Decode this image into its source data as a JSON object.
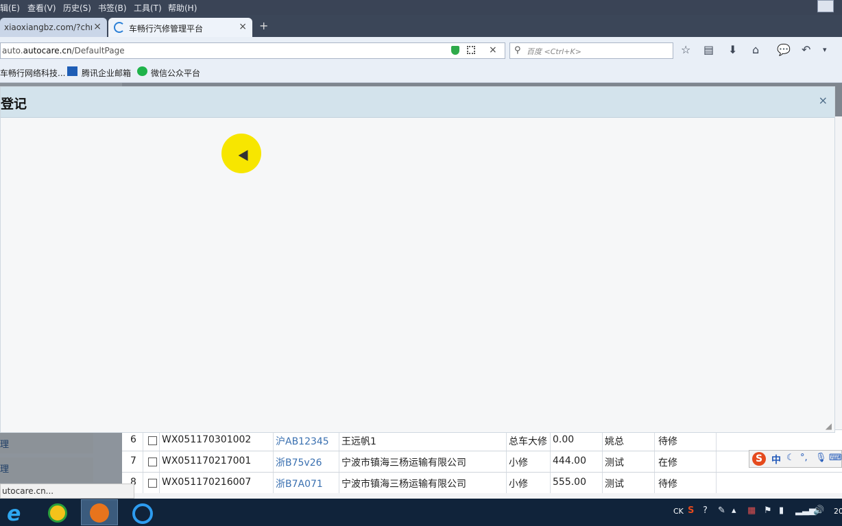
{
  "menu": {
    "items": [
      "辑(E)",
      "查看(V)",
      "历史(S)",
      "书签(B)",
      "工具(T)",
      "帮助(H)"
    ]
  },
  "tabs": [
    {
      "label": "xiaoxiangbz.com/?chn",
      "close": "×"
    },
    {
      "label": "车畅行汽修管理平台",
      "close": "×",
      "active": true
    }
  ],
  "new_tab_label": "+",
  "address": {
    "prefix": "auto.",
    "domain": "autocare.cn",
    "path": "/DefaultPage",
    "clear": "×"
  },
  "search": {
    "placeholder": "百度 <Ctrl+K>",
    "icon": "magnifier-icon"
  },
  "bookmarks": [
    {
      "label": "车畅行网络科技..."
    },
    {
      "label": "腾讯企业邮箱"
    },
    {
      "label": "微信公众平台"
    }
  ],
  "modal": {
    "title": "登记",
    "close": "×"
  },
  "table": {
    "rows": [
      {
        "no": "6",
        "code": "WX051170301002",
        "plate": "沪AB12345",
        "owner": "王远帆1",
        "type": "总车大修",
        "amount": "0.00",
        "user": "姚总",
        "status": "待修"
      },
      {
        "no": "7",
        "code": "WX051170217001",
        "plate": "浙B75v26",
        "owner": "宁波市镇海三杨运输有限公司",
        "type": "小修",
        "amount": "444.00",
        "user": "测试",
        "status": "在修"
      },
      {
        "no": "8",
        "code": "WX051170216007",
        "plate": "浙B7A071",
        "owner": "宁波市镇海三杨运输有限公司",
        "type": "小修",
        "amount": "555.00",
        "user": "测试",
        "status": "待修"
      }
    ]
  },
  "sidebar_fragments": [
    "理",
    "理"
  ],
  "status_tooltip": "utocare.cn...",
  "ime": {
    "logo": "S",
    "mode": "中"
  },
  "tray": {
    "lang": "CK",
    "clock": "20"
  },
  "colors": {
    "taskbar": "#10233a",
    "modal_header": "#d3e3ec",
    "plate_link": "#3a70b0",
    "cursor_highlight": "#f7e600"
  }
}
